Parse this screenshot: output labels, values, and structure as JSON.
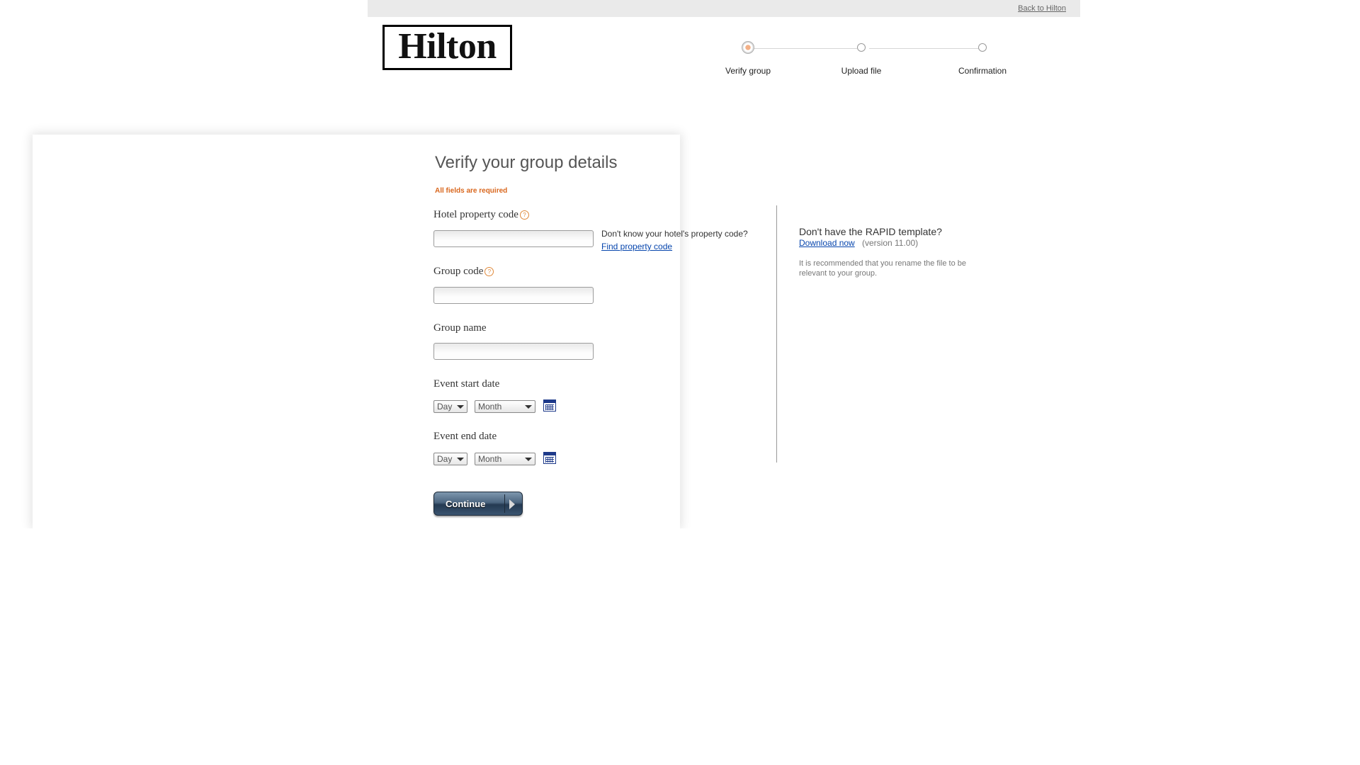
{
  "header": {
    "back_link": "Back to Hilton",
    "logo_text": "Hilton"
  },
  "steps": [
    {
      "label": "Verify group",
      "state": "active"
    },
    {
      "label": "Upload file",
      "state": "pending"
    },
    {
      "label": "Confirmation",
      "state": "pending"
    }
  ],
  "form": {
    "heading": "Verify your group details",
    "required_note": "All fields are required",
    "help_glyph": "?",
    "fields": {
      "property_code": {
        "label": "Hotel property code",
        "value": ""
      },
      "group_code": {
        "label": "Group code",
        "value": ""
      },
      "group_name": {
        "label": "Group name",
        "value": ""
      },
      "start_date": {
        "label": "Event start date",
        "day": "Day",
        "month": "Month"
      },
      "end_date": {
        "label": "Event end date",
        "day": "Day",
        "month": "Month"
      }
    },
    "property_hint": "Don't know your hotel's property code?",
    "find_link": "Find property code",
    "continue_label": "Continue"
  },
  "sidebar": {
    "title": "Don't have the RAPID template?",
    "download_link": "Download now",
    "version": "(version 11.00)",
    "note": "It is recommended that you rename the file to be relevant to your group."
  },
  "colors": {
    "accent": "#d9661c",
    "link": "#0645ad",
    "button": "#3a5470",
    "topbar": "#eaeaea"
  },
  "icons": [
    "help-icon",
    "calendar-icon",
    "arrow-right-icon",
    "chevron-down-icon"
  ]
}
